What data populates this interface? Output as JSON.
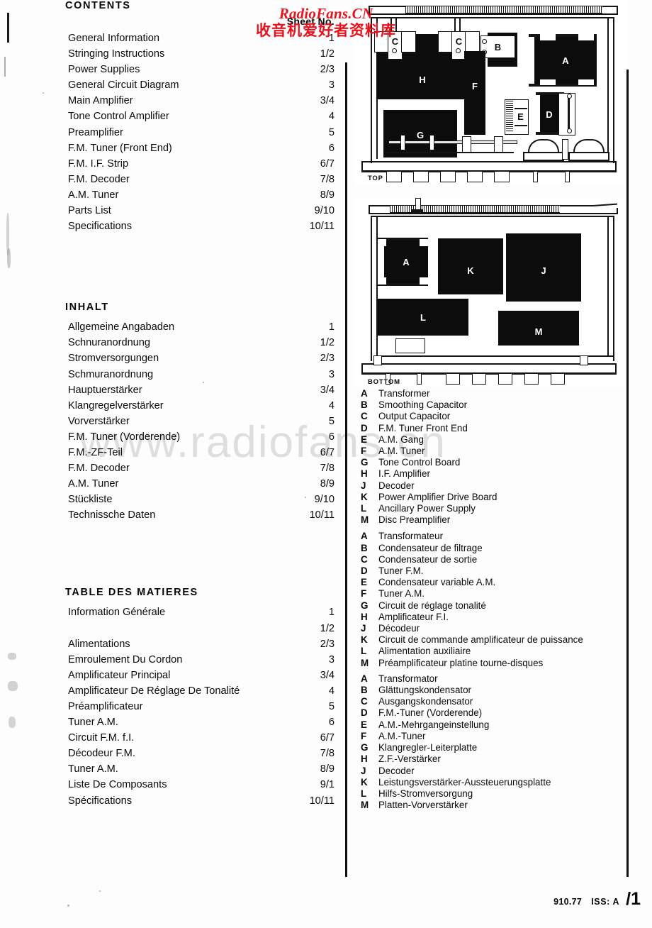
{
  "watermark": {
    "latin": "RadioFans.CN",
    "cjk": "收音机爱好者资料库",
    "middle": "www.radiofans.cn"
  },
  "contents_en": {
    "title": "CONTENTS",
    "column_header": "Sheet No.",
    "rows": [
      {
        "label": "General Information",
        "page": "1"
      },
      {
        "label": "Stringing Instructions",
        "page": "1/2"
      },
      {
        "label": "Power Supplies",
        "page": "2/3"
      },
      {
        "label": "General Circuit Diagram",
        "page": "3"
      },
      {
        "label": "Main Amplifier",
        "page": "3/4"
      },
      {
        "label": "Tone Control Amplifier",
        "page": "4"
      },
      {
        "label": "Preamplifier",
        "page": "5"
      },
      {
        "label": "F.M. Tuner (Front End)",
        "page": "6"
      },
      {
        "label": "F.M. I.F. Strip",
        "page": "6/7"
      },
      {
        "label": "F.M. Decoder",
        "page": "7/8"
      },
      {
        "label": "A.M. Tuner",
        "page": "8/9"
      },
      {
        "label": "Parts List",
        "page": "9/10"
      },
      {
        "label": "Specifications",
        "page": "10/11"
      }
    ]
  },
  "contents_de": {
    "title": "INHALT",
    "rows": [
      {
        "label": "Allgemeine Angabaden",
        "page": "1"
      },
      {
        "label": "Schnuranordnung",
        "page": "1/2"
      },
      {
        "label": "Stromversorgungen",
        "page": "2/3"
      },
      {
        "label": "Schmuranordnung",
        "page": "3"
      },
      {
        "label": "Hauptuerstärker",
        "page": "3/4"
      },
      {
        "label": "Klangregelverstärker",
        "page": "4"
      },
      {
        "label": "Vorverstärker",
        "page": "5"
      },
      {
        "label": "F.M. Tuner (Vorderende)",
        "page": "6"
      },
      {
        "label": "F.M.-ZF-Teil",
        "page": "6/7"
      },
      {
        "label": "F.M. Decoder",
        "page": "7/8"
      },
      {
        "label": "A.M. Tuner",
        "page": "8/9"
      },
      {
        "label": "Stückliste",
        "page": "9/10"
      },
      {
        "label": "Technissche Daten",
        "page": "10/11"
      }
    ]
  },
  "contents_fr": {
    "title": "TABLE DES MATIERES",
    "rows": [
      {
        "label": "Information Générale",
        "page": "1"
      },
      {
        "label": "",
        "page": "1/2"
      },
      {
        "label": "Alimentations",
        "page": "2/3"
      },
      {
        "label": "Emroulement Du Cordon",
        "page": "3"
      },
      {
        "label": "Amplificateur Principal",
        "page": "3/4"
      },
      {
        "label": "Amplificateur De Réglage De Tonalité",
        "page": "4"
      },
      {
        "label": "Préamplificateur",
        "page": "5"
      },
      {
        "label": "Tuner A.M.",
        "page": "6"
      },
      {
        "label": "Circuit F.M. f.I.",
        "page": "6/7"
      },
      {
        "label": "Décodeur F.M.",
        "page": "7/8"
      },
      {
        "label": "Tuner A.M.",
        "page": "8/9"
      },
      {
        "label": "Liste De Composants",
        "page": "9/1"
      },
      {
        "label": "Spécifications",
        "page": "10/11"
      }
    ]
  },
  "diagrams": {
    "top": {
      "view_label": "TOP",
      "blocks": [
        {
          "key": "C"
        },
        {
          "key": "C"
        },
        {
          "key": "B"
        },
        {
          "key": "A"
        },
        {
          "key": "H"
        },
        {
          "key": "F"
        },
        {
          "key": "E"
        },
        {
          "key": "D"
        },
        {
          "key": "G"
        }
      ]
    },
    "bottom": {
      "view_label": "BOTTOM",
      "blocks": [
        {
          "key": "A"
        },
        {
          "key": "K"
        },
        {
          "key": "J"
        },
        {
          "key": "L"
        },
        {
          "key": "M"
        }
      ]
    }
  },
  "legend_en": [
    {
      "key": "A",
      "text": "Transformer"
    },
    {
      "key": "B",
      "text": "Smoothing Capacitor"
    },
    {
      "key": "C",
      "text": "Output Capacitor"
    },
    {
      "key": "D",
      "text": "F.M. Tuner Front End"
    },
    {
      "key": "E",
      "text": "A.M. Gang"
    },
    {
      "key": "F",
      "text": "A.M. Tuner"
    },
    {
      "key": "G",
      "text": "Tone Control Board"
    },
    {
      "key": "H",
      "text": "I.F. Amplifier"
    },
    {
      "key": "J",
      "text": "Decoder"
    },
    {
      "key": "K",
      "text": "Power Amplifier Drive Board"
    },
    {
      "key": "L",
      "text": "Ancillary Power Supply"
    },
    {
      "key": "M",
      "text": "Disc Preamplifier"
    }
  ],
  "legend_fr": [
    {
      "key": "A",
      "text": "Transformateur"
    },
    {
      "key": "B",
      "text": "Condensateur de filtrage"
    },
    {
      "key": "C",
      "text": "Condensateur de sortie"
    },
    {
      "key": "D",
      "text": "Tuner F.M."
    },
    {
      "key": "E",
      "text": "Condensateur variable A.M."
    },
    {
      "key": "F",
      "text": "Tuner A.M."
    },
    {
      "key": "G",
      "text": "Circuit de réglage tonalité"
    },
    {
      "key": "H",
      "text": "Amplificateur F.I."
    },
    {
      "key": "J",
      "text": "Décodeur"
    },
    {
      "key": "K",
      "text": "Circuit de commande amplificateur de puissance"
    },
    {
      "key": "L",
      "text": "Alimentation auxiliaire"
    },
    {
      "key": "M",
      "text": "Préamplificateur platine tourne-disques"
    }
  ],
  "legend_de": [
    {
      "key": "A",
      "text": "Transformator"
    },
    {
      "key": "B",
      "text": "Glättungskondensator"
    },
    {
      "key": "C",
      "text": "Ausgangskondensator"
    },
    {
      "key": "D",
      "text": "F.M.-Tuner (Vorderende)"
    },
    {
      "key": "E",
      "text": "A.M.-Mehrgangeinstellung"
    },
    {
      "key": "F",
      "text": "A.M.-Tuner"
    },
    {
      "key": "G",
      "text": "Klangregler-Leiterplatte"
    },
    {
      "key": "H",
      "text": "Z.F.-Verstärker"
    },
    {
      "key": "J",
      "text": "Decoder"
    },
    {
      "key": "K",
      "text": "Leistungsverstärker-Aussteuerungsplatte"
    },
    {
      "key": "L",
      "text": "Hilfs-Stromversorgung"
    },
    {
      "key": "M",
      "text": "Platten-Vorverstärker"
    }
  ],
  "footer": {
    "doc_code": "910.77",
    "issue": "ISS: A",
    "sheet": "/1"
  }
}
